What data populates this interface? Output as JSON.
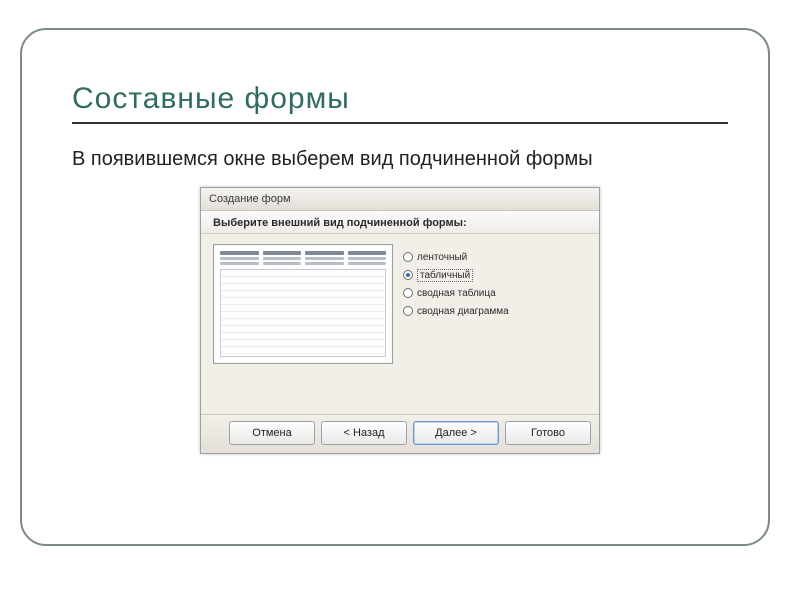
{
  "slide": {
    "title": "Составные формы",
    "body": "В появившемся окне выберем вид подчиненной формы"
  },
  "dialog": {
    "title": "Создание форм",
    "instruction": "Выберите внешний вид подчиненной формы:",
    "options": [
      {
        "label": "ленточный",
        "selected": false
      },
      {
        "label": "табличный",
        "selected": true
      },
      {
        "label": "сводная таблица",
        "selected": false
      },
      {
        "label": "сводная диаграмма",
        "selected": false
      }
    ],
    "buttons": {
      "cancel": "Отмена",
      "back": "< Назад",
      "next": "Далее >",
      "finish": "Готово"
    }
  }
}
